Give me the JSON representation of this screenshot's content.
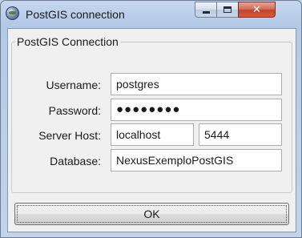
{
  "window": {
    "title": "PostGIS connection"
  },
  "group": {
    "legend": "PostGIS Connection",
    "username": {
      "label": "Username:",
      "value": "postgres"
    },
    "password": {
      "label": "Password:",
      "value": "●●●●●●●●"
    },
    "server": {
      "label": "Server Host:",
      "host": "localhost",
      "port": "5444"
    },
    "database": {
      "label": "Database:",
      "value": "NexusExemploPostGIS"
    }
  },
  "ok_label": "OK"
}
